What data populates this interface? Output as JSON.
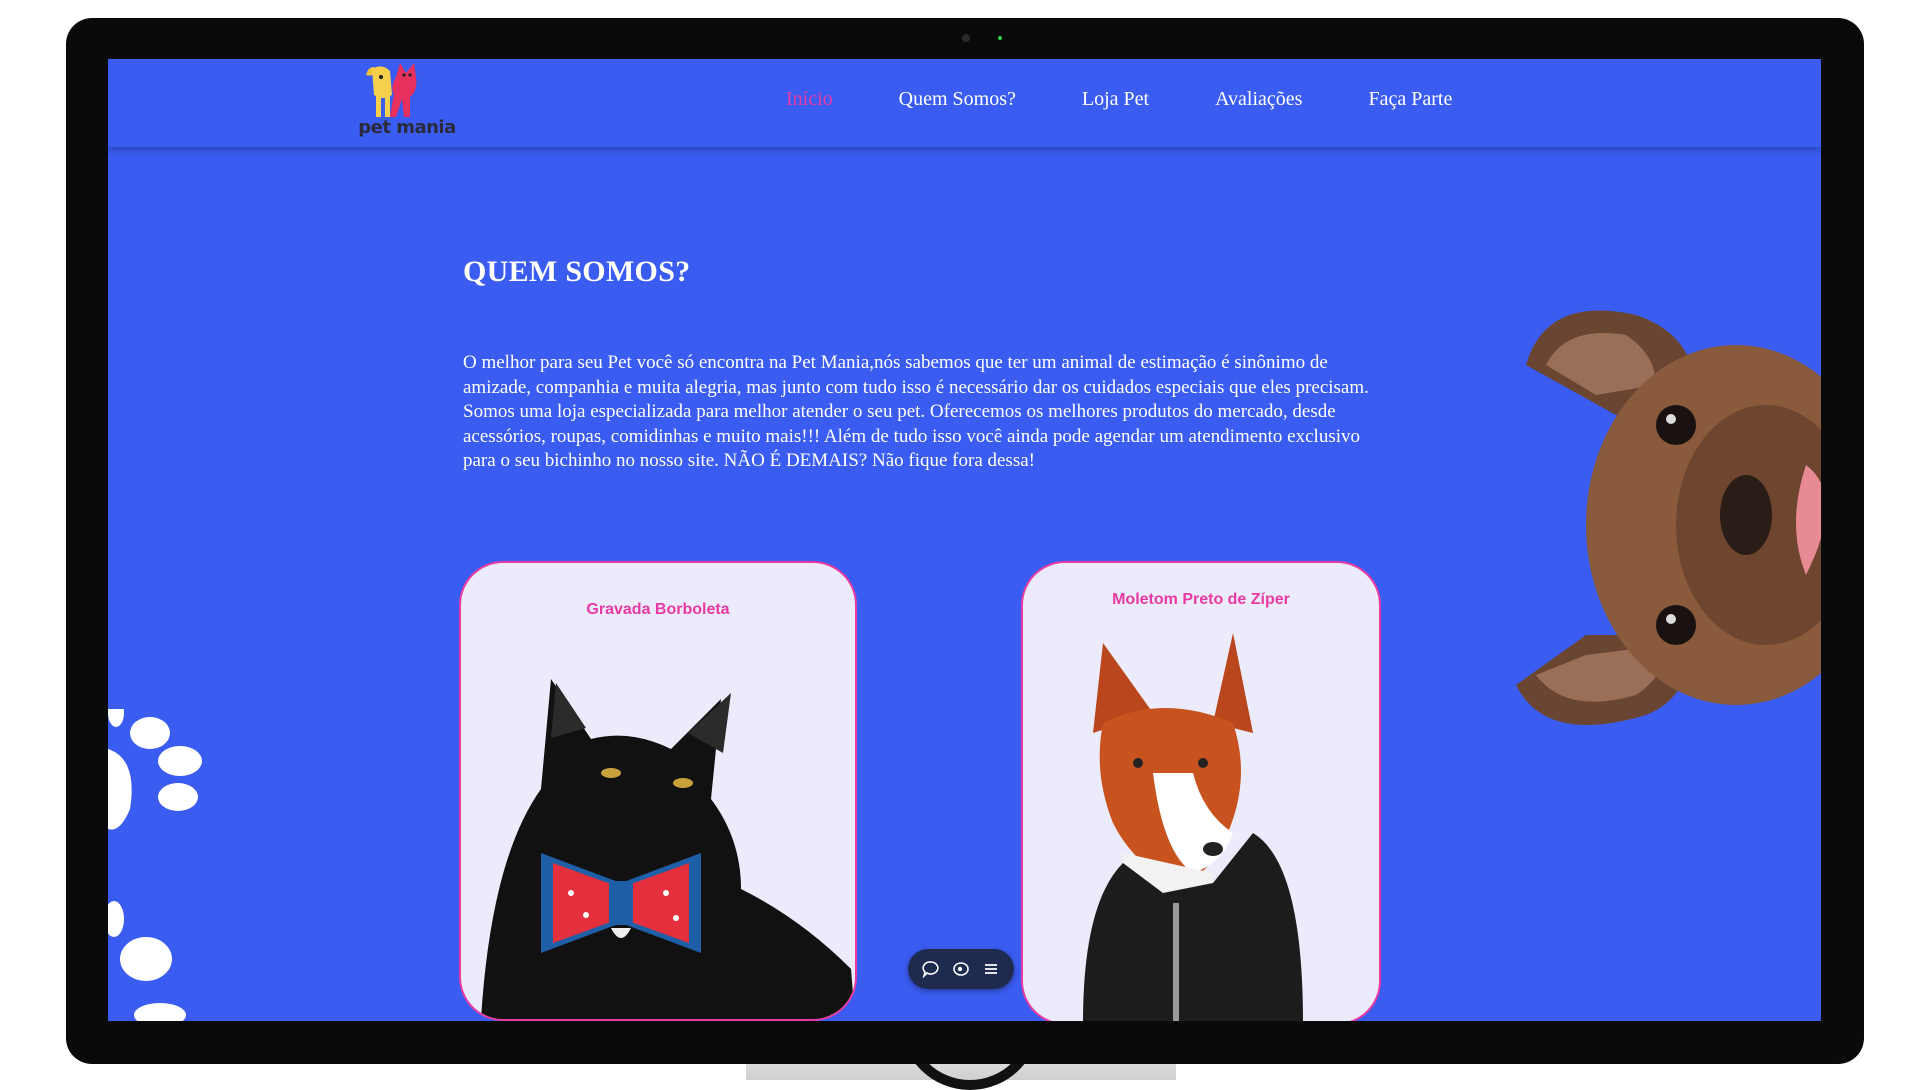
{
  "brand": {
    "logo_text": "pet mania"
  },
  "nav": {
    "items": [
      {
        "label": "Início",
        "active": true
      },
      {
        "label": "Quem Somos?",
        "active": false
      },
      {
        "label": "Loja Pet",
        "active": false
      },
      {
        "label": "Avaliações",
        "active": false
      },
      {
        "label": "Faça Parte",
        "active": false
      }
    ]
  },
  "about": {
    "title": "QUEM SOMOS?",
    "text": "O melhor para seu Pet você só encontra na Pet Mania,nós sabemos que ter um animal de estimação é sinônimo de amizade, companhia e muita alegria, mas junto com tudo isso é necessário dar os cuidados especiais que eles precisam. Somos uma loja especializada para melhor atender o seu pet. Oferecemos os melhores produtos do mercado, desde acessórios, roupas, comidinhas e muito mais!!! Além de tudo isso você ainda pode agendar um atendimento exclusivo para o seu bichinho no nosso site. NÃO É DEMAIS? Não fique fora dessa!"
  },
  "products": [
    {
      "title": "Gravada Borboleta",
      "image": "black-cat-with-bowtie"
    },
    {
      "title": "Moletom Preto de Zíper",
      "image": "dog-in-black-hoodie"
    }
  ],
  "widget": {
    "icons": [
      "chat-icon",
      "eye-icon",
      "menu-icon"
    ]
  },
  "decor": {
    "paws": "white-paw-prints",
    "dog": "french-bulldog-peeking"
  },
  "colors": {
    "background": "#3a5cf0",
    "accent": "#e83aa3",
    "card": "#ecebfb",
    "text": "#ffffff"
  }
}
